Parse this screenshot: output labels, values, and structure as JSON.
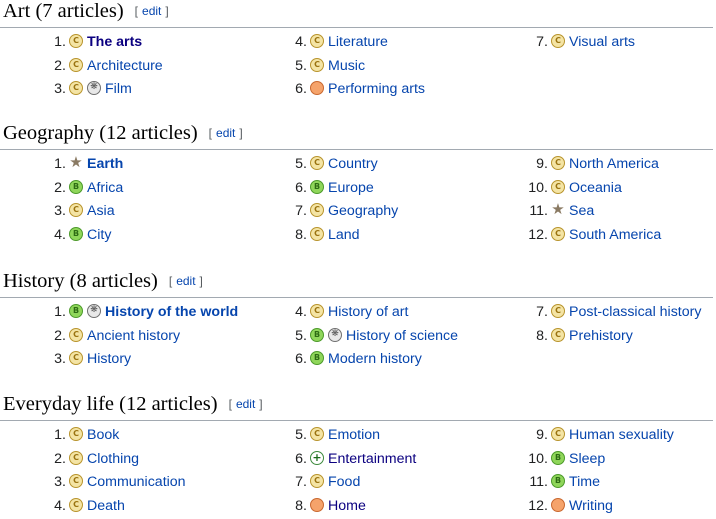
{
  "edit_label": "edit",
  "sections": [
    {
      "title": "Art (7 articles)",
      "columns": [
        [
          {
            "num": "1.",
            "badges": [
              "c-class"
            ],
            "label": "The arts",
            "style": "bold-new"
          },
          {
            "num": "2.",
            "badges": [
              "c-class"
            ],
            "label": "Architecture"
          },
          {
            "num": "3.",
            "badges": [
              "c-class",
              "portal"
            ],
            "label": "Film"
          }
        ],
        [
          {
            "num": "4.",
            "badges": [
              "c-class"
            ],
            "label": "Literature"
          },
          {
            "num": "5.",
            "badges": [
              "c-class"
            ],
            "label": "Music"
          },
          {
            "num": "6.",
            "badges": [
              "start-class"
            ],
            "label": "Performing arts"
          }
        ],
        [
          {
            "num": "7.",
            "badges": [
              "c-class"
            ],
            "label": "Visual arts"
          }
        ]
      ]
    },
    {
      "title": "Geography (12 articles)",
      "columns": [
        [
          {
            "num": "1.",
            "badges": [
              "featured-star"
            ],
            "label": "Earth",
            "style": "bold"
          },
          {
            "num": "2.",
            "badges": [
              "b-class"
            ],
            "label": "Africa"
          },
          {
            "num": "3.",
            "badges": [
              "c-class"
            ],
            "label": "Asia"
          },
          {
            "num": "4.",
            "badges": [
              "b-class"
            ],
            "label": "City"
          }
        ],
        [
          {
            "num": "5.",
            "badges": [
              "c-class"
            ],
            "label": "Country"
          },
          {
            "num": "6.",
            "badges": [
              "b-class"
            ],
            "label": "Europe"
          },
          {
            "num": "7.",
            "badges": [
              "c-class"
            ],
            "label": "Geography"
          },
          {
            "num": "8.",
            "badges": [
              "c-class"
            ],
            "label": "Land"
          }
        ],
        [
          {
            "num": "9.",
            "badges": [
              "c-class"
            ],
            "label": "North America"
          },
          {
            "num": "10.",
            "badges": [
              "c-class"
            ],
            "label": "Oceania"
          },
          {
            "num": "11.",
            "badges": [
              "featured-star"
            ],
            "label": "Sea"
          },
          {
            "num": "12.",
            "badges": [
              "c-class"
            ],
            "label": "South America"
          }
        ]
      ]
    },
    {
      "title": "History (8 articles)",
      "columns": [
        [
          {
            "num": "1.",
            "badges": [
              "b-class",
              "portal"
            ],
            "label": "History of the world",
            "style": "bold"
          },
          {
            "num": "2.",
            "badges": [
              "c-class"
            ],
            "label": "Ancient history"
          },
          {
            "num": "3.",
            "badges": [
              "c-class"
            ],
            "label": "History"
          }
        ],
        [
          {
            "num": "4.",
            "badges": [
              "c-class"
            ],
            "label": "History of art"
          },
          {
            "num": "5.",
            "badges": [
              "b-class",
              "portal"
            ],
            "label": "History of science"
          },
          {
            "num": "6.",
            "badges": [
              "b-class"
            ],
            "label": "Modern history"
          }
        ],
        [
          {
            "num": "7.",
            "badges": [
              "c-class"
            ],
            "label": "Post-classical history"
          },
          {
            "num": "8.",
            "badges": [
              "c-class"
            ],
            "label": "Prehistory"
          }
        ]
      ]
    },
    {
      "title": "Everyday life (12 articles)",
      "columns": [
        [
          {
            "num": "1.",
            "badges": [
              "c-class"
            ],
            "label": "Book"
          },
          {
            "num": "2.",
            "badges": [
              "c-class"
            ],
            "label": "Clothing"
          },
          {
            "num": "3.",
            "badges": [
              "c-class"
            ],
            "label": "Communication"
          },
          {
            "num": "4.",
            "badges": [
              "c-class"
            ],
            "label": "Death"
          }
        ],
        [
          {
            "num": "5.",
            "badges": [
              "c-class"
            ],
            "label": "Emotion"
          },
          {
            "num": "6.",
            "badges": [
              "list-class"
            ],
            "label": "Entertainment",
            "style": "new"
          },
          {
            "num": "7.",
            "badges": [
              "c-class"
            ],
            "label": "Food"
          },
          {
            "num": "8.",
            "badges": [
              "start-class"
            ],
            "label": "Home",
            "style": "new"
          }
        ],
        [
          {
            "num": "9.",
            "badges": [
              "c-class"
            ],
            "label": "Human sexuality"
          },
          {
            "num": "10.",
            "badges": [
              "b-class"
            ],
            "label": "Sleep"
          },
          {
            "num": "11.",
            "badges": [
              "b-class"
            ],
            "label": "Time"
          },
          {
            "num": "12.",
            "badges": [
              "start-class"
            ],
            "label": "Writing"
          }
        ]
      ]
    }
  ]
}
